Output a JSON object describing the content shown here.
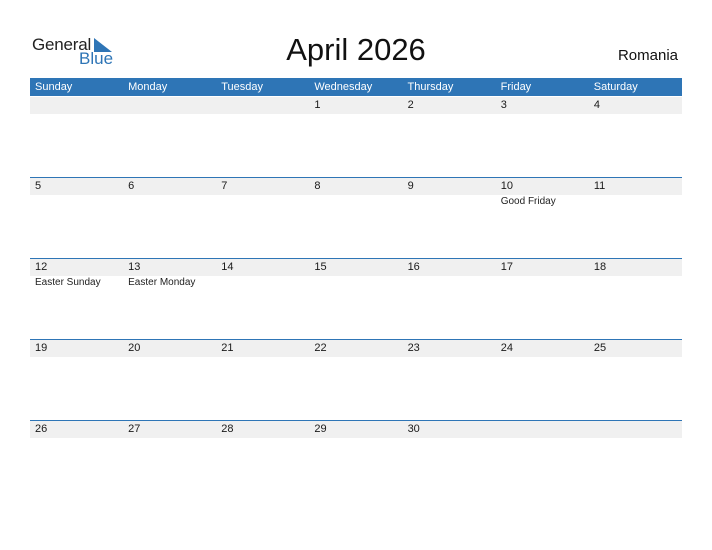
{
  "logo": {
    "line1": "General",
    "line2": "Blue"
  },
  "title": "April 2026",
  "country": "Romania",
  "colors": {
    "accent": "#2E75B6",
    "band": "#F0F0F0"
  },
  "weekdays": [
    "Sunday",
    "Monday",
    "Tuesday",
    "Wednesday",
    "Thursday",
    "Friday",
    "Saturday"
  ],
  "weeks": [
    [
      {
        "day": ""
      },
      {
        "day": ""
      },
      {
        "day": ""
      },
      {
        "day": "1"
      },
      {
        "day": "2"
      },
      {
        "day": "3"
      },
      {
        "day": "4"
      }
    ],
    [
      {
        "day": "5"
      },
      {
        "day": "6"
      },
      {
        "day": "7"
      },
      {
        "day": "8"
      },
      {
        "day": "9"
      },
      {
        "day": "10",
        "holiday": "Good Friday"
      },
      {
        "day": "11"
      }
    ],
    [
      {
        "day": "12",
        "holiday": "Easter Sunday"
      },
      {
        "day": "13",
        "holiday": "Easter Monday"
      },
      {
        "day": "14"
      },
      {
        "day": "15"
      },
      {
        "day": "16"
      },
      {
        "day": "17"
      },
      {
        "day": "18"
      }
    ],
    [
      {
        "day": "19"
      },
      {
        "day": "20"
      },
      {
        "day": "21"
      },
      {
        "day": "22"
      },
      {
        "day": "23"
      },
      {
        "day": "24"
      },
      {
        "day": "25"
      }
    ],
    [
      {
        "day": "26"
      },
      {
        "day": "27"
      },
      {
        "day": "28"
      },
      {
        "day": "29"
      },
      {
        "day": "30"
      },
      {
        "day": ""
      },
      {
        "day": ""
      }
    ]
  ]
}
